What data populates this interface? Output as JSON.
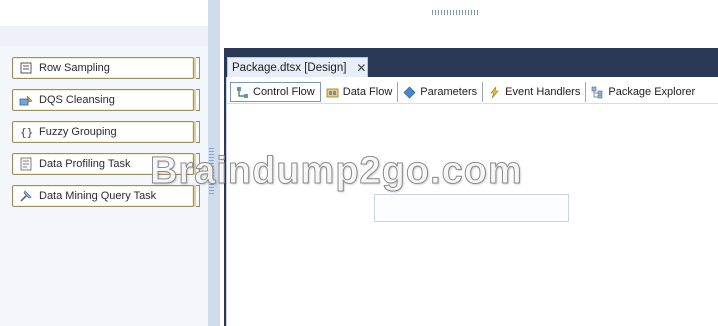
{
  "toolbox": {
    "items": [
      {
        "label": "Row Sampling",
        "icon": "row-sampling-icon"
      },
      {
        "label": "DQS Cleansing",
        "icon": "dqs-cleansing-icon"
      },
      {
        "label": "Fuzzy Grouping",
        "icon": "fuzzy-grouping-icon"
      },
      {
        "label": "Data Profiling Task",
        "icon": "data-profiling-icon"
      },
      {
        "label": "Data Mining Query Task",
        "icon": "data-mining-icon"
      }
    ]
  },
  "document": {
    "tab_title": "Package.dtsx [Design]",
    "close_glyph": "✕"
  },
  "designer_tabs": [
    {
      "label": "Control Flow",
      "icon": "control-flow-icon"
    },
    {
      "label": "Data Flow",
      "icon": "data-flow-icon"
    },
    {
      "label": "Parameters",
      "icon": "parameters-icon"
    },
    {
      "label": "Event Handlers",
      "icon": "event-handlers-icon"
    },
    {
      "label": "Package Explorer",
      "icon": "package-explorer-icon"
    }
  ],
  "watermark": "Braindump2go.com",
  "colors": {
    "designer_header": "#293955",
    "splitter": "#cfdcee",
    "toolbox_border": "#9c8e63"
  }
}
